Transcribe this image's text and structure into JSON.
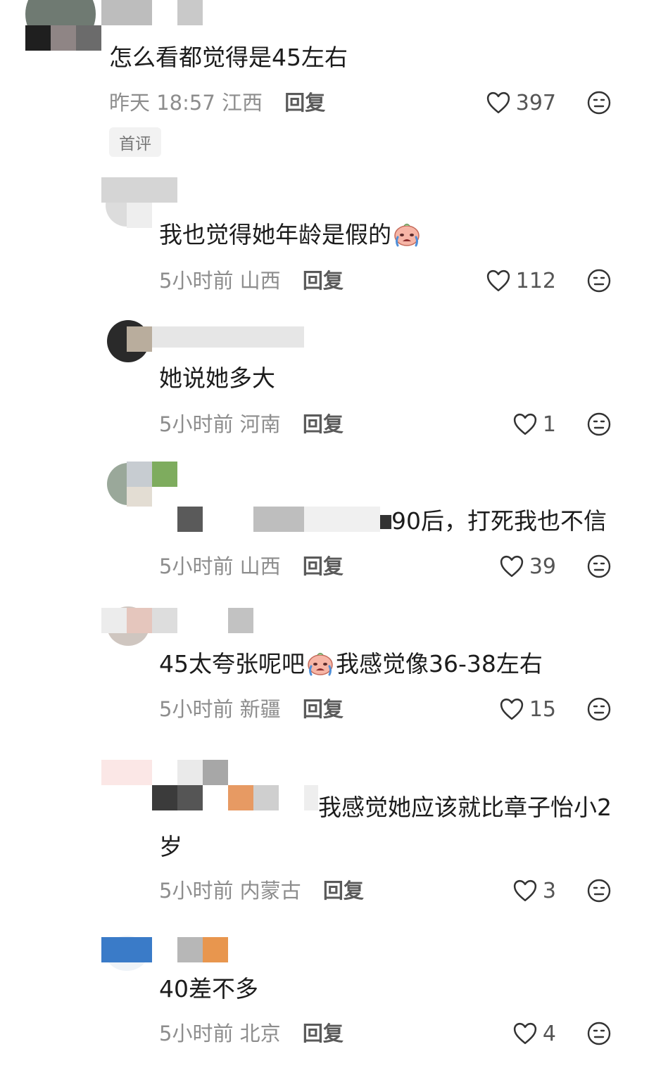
{
  "comments": [
    {
      "text": "怎么看都觉得是45左右",
      "time": "昨天 18:57",
      "location": "江西",
      "reply": "回复",
      "likes": "397",
      "badge": "首评"
    },
    {
      "text": "我也觉得她年龄是假的",
      "time": "5小时前",
      "location": "山西",
      "reply": "回复",
      "likes": "112"
    },
    {
      "text": "她说她多大",
      "time": "5小时前",
      "location": "河南",
      "reply": "回复",
      "likes": "1"
    },
    {
      "text": "90后，打死我也不信",
      "time": "5小时前",
      "location": "山西",
      "reply": "回复",
      "likes": "39"
    },
    {
      "text_a": "45太夸张呢吧",
      "text_b": "我感觉像36-38左右",
      "time": "5小时前",
      "location": "新疆",
      "reply": "回复",
      "likes": "15"
    },
    {
      "text": "我感觉她应该就比章子怡小2",
      "text_cont": "岁",
      "time": "5小时前",
      "location": "内蒙古",
      "reply": "回复",
      "likes": "3"
    },
    {
      "text": "40差不多",
      "time": "5小时前",
      "location": "北京",
      "reply": "回复",
      "likes": "4"
    }
  ],
  "colors": {
    "meta": "#8d8d8d",
    "reply": "#5a5a5a",
    "text": "#1c1c1c",
    "badge_bg": "#f2f2f2"
  },
  "icons": {
    "like": "heart-outline-icon",
    "react": "neutral-face-icon",
    "inline_emoji": "crying-face-emoji"
  }
}
